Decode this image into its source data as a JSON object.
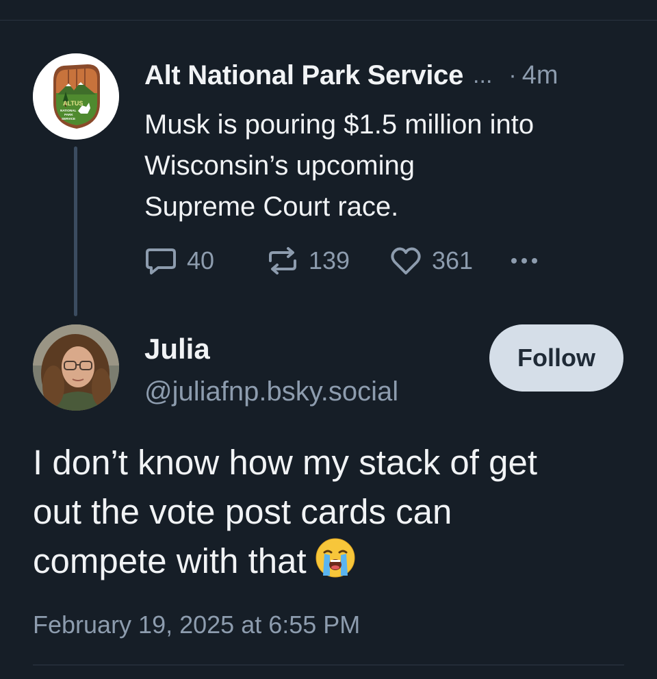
{
  "parent_post": {
    "author_name": "Alt National Park Service",
    "ellipsis": "...",
    "dot": "·",
    "time": "4m",
    "text_lines": [
      "Musk is pouring $1.5 million into",
      "Wisconsin’s upcoming",
      "Supreme Court race."
    ],
    "replies": "40",
    "reposts": "139",
    "likes": "361",
    "avatar_icon": "altus-national-park-service-logo",
    "logo_text": [
      "ALTUS",
      "NATIONAL",
      "PARK",
      "SERVICE"
    ]
  },
  "reply_post": {
    "author_name": "Julia",
    "handle": "@juliafnp.bsky.social",
    "follow_label": "Follow",
    "text_lines": [
      "I don’t know how my stack of get",
      "out the vote post cards can",
      "compete with that"
    ],
    "emoji": "loudly-crying-face",
    "timestamp": "February 19, 2025 at 6:55 PM"
  },
  "colors": {
    "background": "#161e27",
    "text_primary": "#f1f3f5",
    "text_secondary": "#8d9cae",
    "follow_button_bg": "#d5dee8",
    "thread_line": "#3b4c60"
  }
}
